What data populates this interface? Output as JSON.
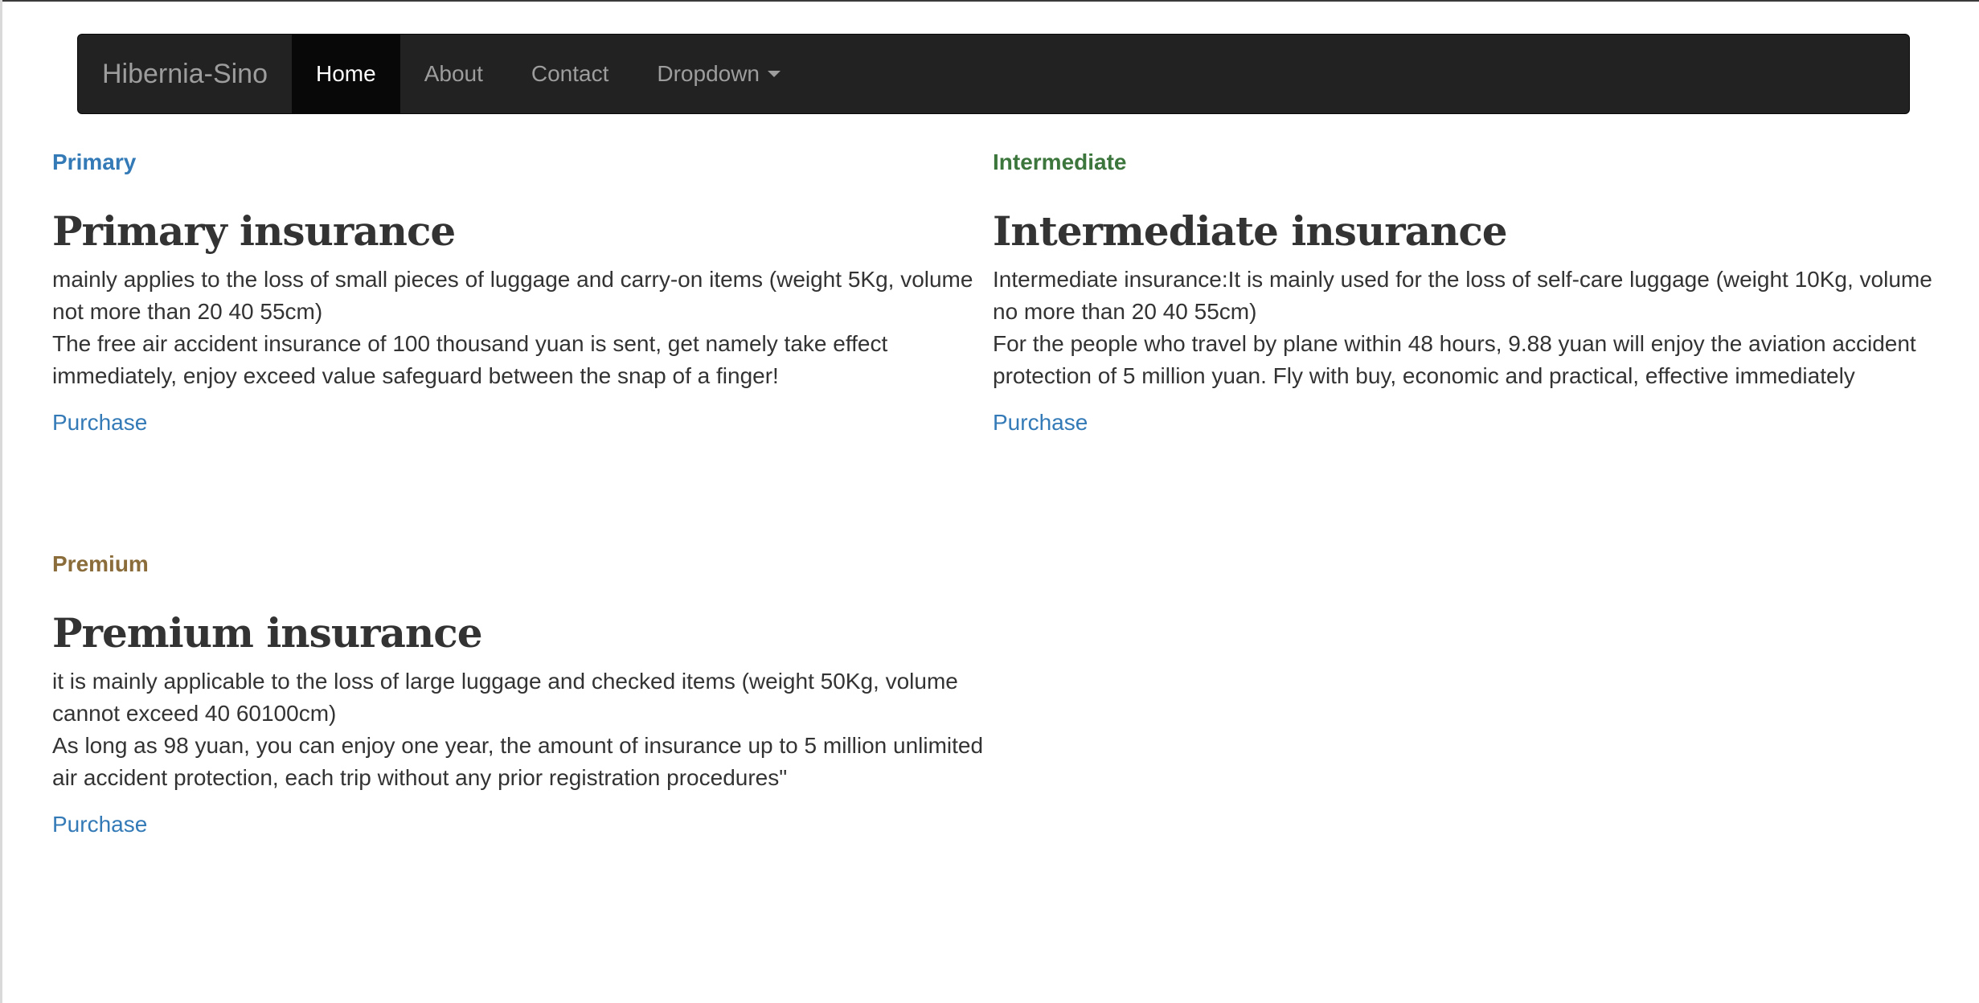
{
  "navbar": {
    "brand": "Hibernia-Sino",
    "items": [
      {
        "label": "Home",
        "active": true
      },
      {
        "label": "About"
      },
      {
        "label": "Contact"
      },
      {
        "label": "Dropdown"
      }
    ]
  },
  "cards": [
    {
      "badge": "Primary",
      "title": "Primary insurance",
      "desc1": "mainly applies to the loss of small pieces of luggage and carry-on items (weight 5Kg, volume not more than 20 40 55cm)",
      "desc2": "The free air accident insurance of 100 thousand yuan is sent, get namely take effect immediately, enjoy exceed value safeguard between the snap of a finger!",
      "link": "Purchase"
    },
    {
      "badge": "Intermediate",
      "title": "Intermediate insurance",
      "desc1": "Intermediate insurance:It is mainly used for the loss of self-care luggage (weight 10Kg, volume no more than 20 40 55cm)",
      "desc2": "For the people who travel by plane within 48 hours, 9.88 yuan will enjoy the aviation accident protection of 5 million yuan. Fly with buy, economic and practical, effective immediately",
      "link": "Purchase"
    },
    {
      "badge": "Premium",
      "title": "Premium insurance",
      "desc1": "it is mainly applicable to the loss of large luggage and checked items (weight 50Kg, volume cannot exceed 40 60100cm)",
      "desc2": "As long as 98 yuan, you can enjoy one year, the amount of insurance up to 5 million unlimited air accident protection, each trip without any prior registration procedures\"",
      "link": "Purchase"
    }
  ],
  "colors": {
    "navbar_bg": "#222222",
    "link": "#337ab7",
    "primary": "#337ab7",
    "intermediate": "#3c763d",
    "premium": "#8a6d3b"
  }
}
